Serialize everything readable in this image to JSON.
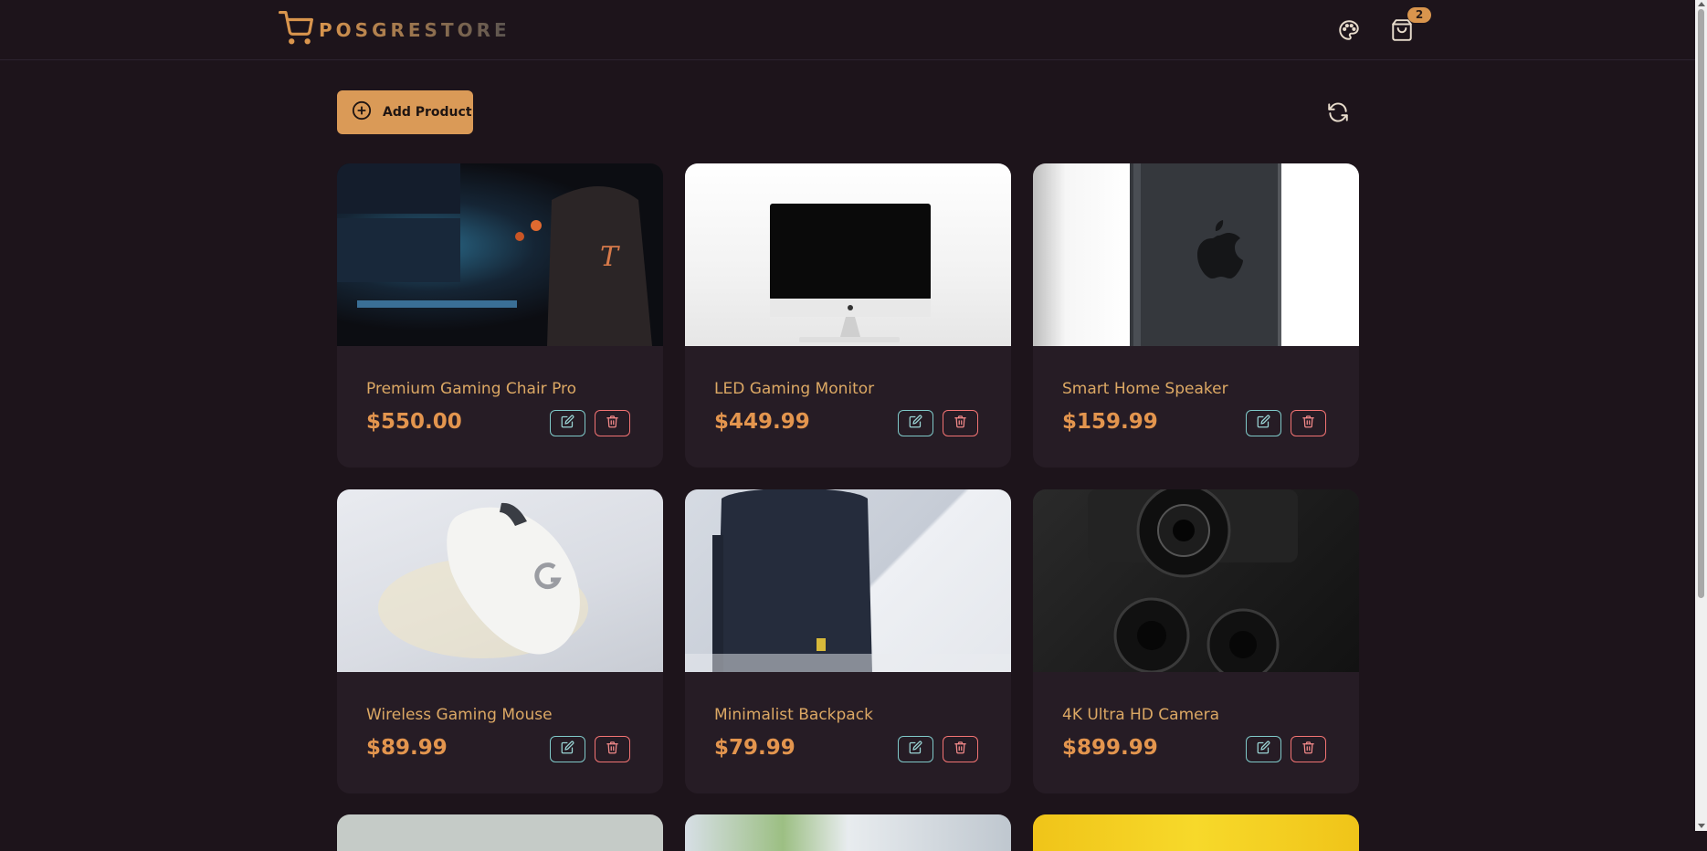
{
  "navbar": {
    "brand": "POSGRESTORE",
    "cart_count": "2",
    "icons": {
      "logo": "shopping-cart-icon",
      "theme": "palette-icon",
      "cart": "shopping-bag-icon"
    }
  },
  "toolbar": {
    "add_label": "Add Product",
    "refresh_icon": "refresh-icon"
  },
  "products": [
    {
      "name": "Premium Gaming Chair Pro",
      "price": "$550.00"
    },
    {
      "name": "LED Gaming Monitor",
      "price": "$449.99"
    },
    {
      "name": "Smart Home Speaker",
      "price": "$159.99"
    },
    {
      "name": "Wireless Gaming Mouse",
      "price": "$89.99"
    },
    {
      "name": "Minimalist Backpack",
      "price": "$79.99"
    },
    {
      "name": "4K Ultra HD Camera",
      "price": "$899.99"
    }
  ],
  "colors": {
    "background": "#1d141b",
    "card": "#261c25",
    "accent": "#da9a57",
    "price": "#e3954e",
    "edit": "#7fc9c9",
    "delete": "#f27373"
  }
}
